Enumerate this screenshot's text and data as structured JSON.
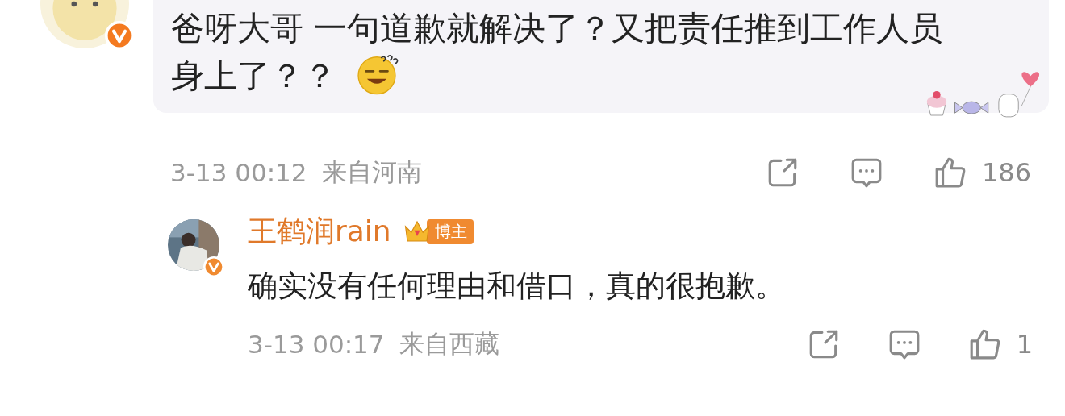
{
  "comment": {
    "text": "爸呀大哥 一句道歉就解决了？又把责任推到工作人员身上了？？",
    "time": "3-13 00:12",
    "location": "来自河南",
    "likes": "186"
  },
  "reply": {
    "author": "王鹤润rain",
    "badge": "博主",
    "text": "确实没有任何理由和借口，真的很抱歉。",
    "time": "3-13 00:17",
    "location": "来自西藏",
    "likes": "1"
  }
}
